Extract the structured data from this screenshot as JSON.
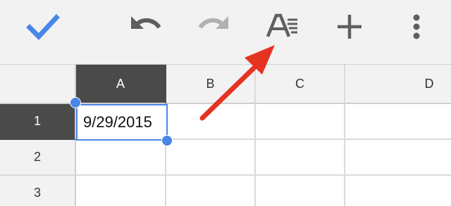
{
  "toolbar": {
    "buttons": [
      {
        "name": "done-checkmark-button",
        "icon": "checkmark-icon",
        "color": "#4a86e8"
      },
      {
        "name": "undo-button",
        "icon": "undo-icon",
        "color": "#5f5f5f"
      },
      {
        "name": "redo-button",
        "icon": "redo-icon",
        "color": "#b0b0b0"
      },
      {
        "name": "text-format-button",
        "icon": "text-format-icon",
        "color": "#5f5f5f"
      },
      {
        "name": "insert-button",
        "icon": "plus-icon",
        "color": "#5f5f5f"
      },
      {
        "name": "more-options-button",
        "icon": "more-vert-icon",
        "color": "#5f5f5f"
      }
    ]
  },
  "sheet": {
    "columns": [
      "A",
      "B",
      "C",
      "D"
    ],
    "rows": [
      "1",
      "2",
      "3"
    ],
    "selected_column": "A",
    "selected_row": "1",
    "cells": {
      "A1": "9/29/2015"
    }
  },
  "colors": {
    "selection": "#4a86e8",
    "header_selected": "#4a4a4a",
    "annotation_arrow": "#e53322"
  },
  "annotation": {
    "type": "arrow",
    "points_to": "text-format-button"
  }
}
